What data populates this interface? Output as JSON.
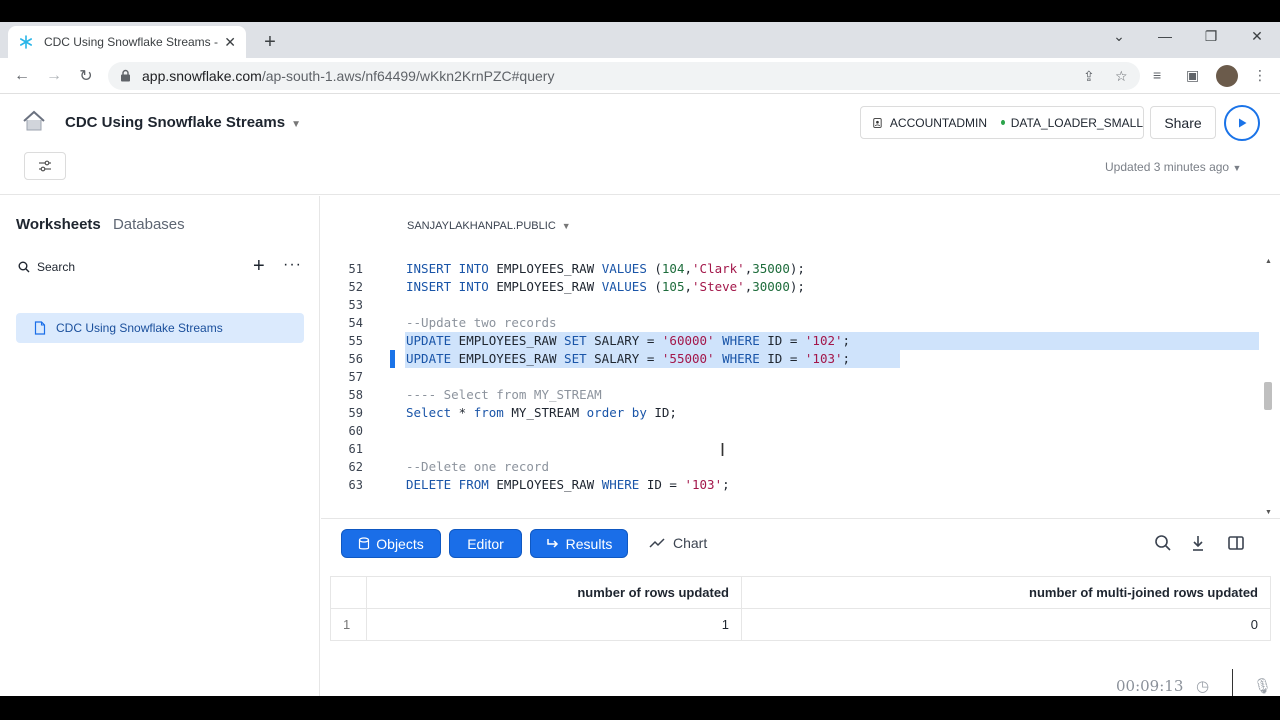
{
  "browser": {
    "tab_title": "CDC Using Snowflake Streams - S",
    "url_host": "app.snowflake.com",
    "url_path": "/ap-south-1.aws/nf64499/wKkn2KrnPZC#query"
  },
  "header": {
    "worksheet_title": "CDC Using Snowflake Streams",
    "role": "ACCOUNTADMIN",
    "warehouse": "DATA_LOADER_SMALL",
    "share_label": "Share",
    "updated_text": "Updated 3 minutes ago"
  },
  "sidebar": {
    "tab_worksheets": "Worksheets",
    "tab_databases": "Databases",
    "search_label": "Search",
    "items": [
      {
        "label": "CDC Using Snowflake Streams"
      }
    ]
  },
  "editor": {
    "context": "SANJAYLAKHANPAL.PUBLIC",
    "lines": [
      {
        "num": "51"
      },
      {
        "num": "52"
      },
      {
        "num": "53"
      },
      {
        "num": "54"
      },
      {
        "num": "55"
      },
      {
        "num": "56"
      },
      {
        "num": "57"
      },
      {
        "num": "58"
      },
      {
        "num": "59"
      },
      {
        "num": "60"
      },
      {
        "num": "61"
      },
      {
        "num": "62"
      },
      {
        "num": "63"
      }
    ]
  },
  "results": {
    "btn_objects": "Objects",
    "btn_editor": "Editor",
    "btn_results": "Results",
    "btn_chart": "Chart",
    "columns": [
      "number of rows updated",
      "number of multi-joined rows updated"
    ],
    "rows": [
      {
        "row_num": "1",
        "values": [
          "1",
          "0"
        ]
      }
    ]
  },
  "recorder": {
    "time": "00:09:13"
  }
}
